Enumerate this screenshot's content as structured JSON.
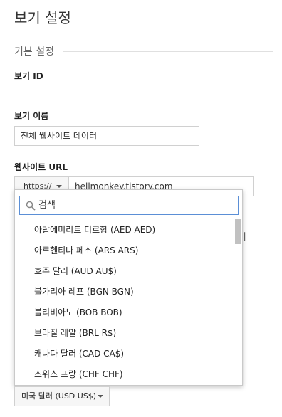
{
  "page": {
    "title": "보기 설정"
  },
  "basic_settings": {
    "section_title": "기본 설정",
    "view_id_label": "보기 ID",
    "view_name_label": "보기 이름",
    "view_name_value": "전체 웹사이트 데이터",
    "website_url_label": "웹사이트 URL",
    "protocol_value": "https://",
    "url_value": "hellmonkey.tistory.com",
    "partially_hidden_char": "ㅏ"
  },
  "currency_dropdown": {
    "search_placeholder": "검색",
    "options": [
      {
        "label": "아랍에미리트 디르함 (AED AED)"
      },
      {
        "label": "아르헨티나 페소 (ARS ARS)"
      },
      {
        "label": "호주 달러 (AUD AU$)"
      },
      {
        "label": "불가리아 레프 (BGN BGN)"
      },
      {
        "label": "볼리비아노 (BOB BOB)"
      },
      {
        "label": "브라질 레알 (BRL R$)"
      },
      {
        "label": "캐나다 달러 (CAD CA$)"
      },
      {
        "label": "스위스 프랑 (CHF CHF)"
      }
    ],
    "selected_value": "미국 달러 (USD US$)"
  },
  "icons": {
    "search": "search-icon",
    "caret": "caret-down-icon"
  },
  "colors": {
    "focus_border": "#5b8fd6",
    "scrollbar": "#c1c1c1"
  }
}
